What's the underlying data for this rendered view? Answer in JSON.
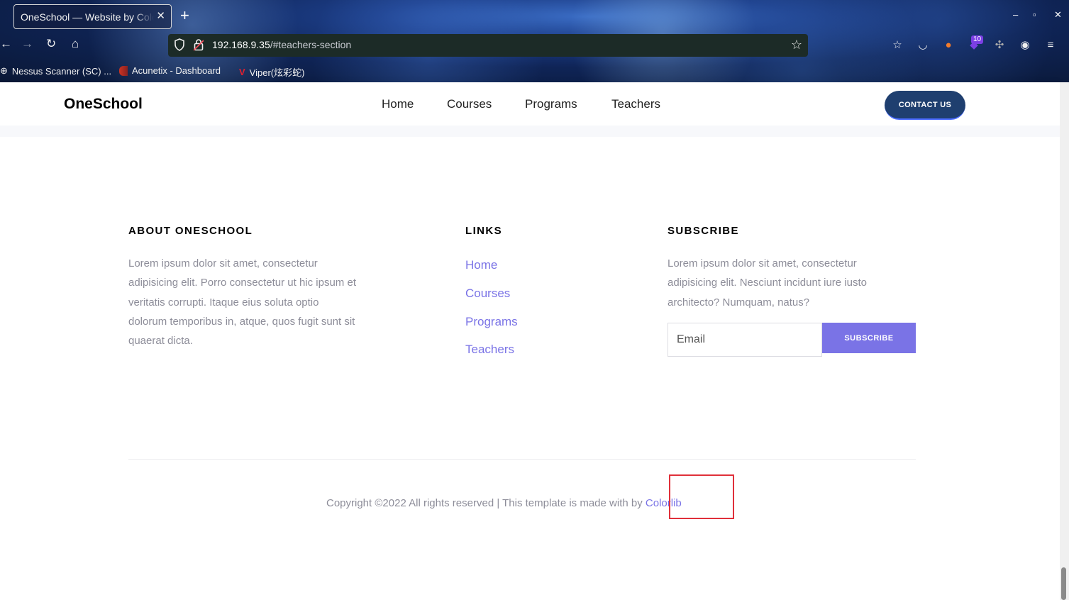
{
  "browser": {
    "tab_title": "OneSchool — Website by Colorlib",
    "url_host": "192.168.9.35",
    "url_path": "/#teachers-section",
    "toolbar_badge": "10",
    "bookmarks": [
      {
        "label": "Nessus Scanner (SC) ..."
      },
      {
        "label": "Acunetix - Dashboard"
      },
      {
        "label": "Viper(炫彩蛇)"
      }
    ]
  },
  "header": {
    "logo": "OneSchool",
    "menu": [
      "Home",
      "Courses",
      "Programs",
      "Teachers"
    ],
    "contact_label": "CONTACT US"
  },
  "footer": {
    "about": {
      "heading": "ABOUT ONESCHOOL",
      "lines": [
        "Lorem ipsum dolor sit amet, consectetur",
        "adipisicing elit. Porro consectetur ut hic ipsum et",
        "veritatis corrupti. Itaque eius soluta optio",
        "dolorum temporibus in, atque, quos fugit sunt sit",
        "quaerat dicta."
      ]
    },
    "links": {
      "heading": "LINKS",
      "items": [
        "Home",
        "Courses",
        "Programs",
        "Teachers"
      ]
    },
    "subscribe": {
      "heading": "SUBSCRIBE",
      "lines": [
        "Lorem ipsum dolor sit amet, consectetur",
        "adipisicing elit. Nesciunt incidunt iure iusto",
        "architecto? Numquam, natus?"
      ],
      "email_placeholder": "Email",
      "button_label": "SUBSCRIBE"
    },
    "copyright_text": "Copyright ©2022 All rights reserved | This template is made with by ",
    "copyright_link": "Colorlib"
  },
  "colors": {
    "accent": "#7a73e6",
    "contact_button": "#1f3f6f",
    "highlight": "#e0303a"
  }
}
